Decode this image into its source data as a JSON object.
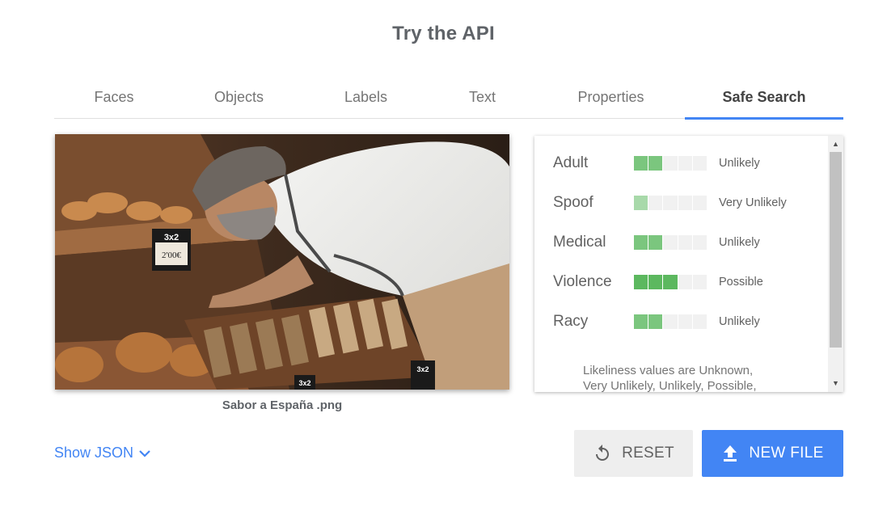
{
  "page": {
    "title": "Try the API"
  },
  "tabs": [
    {
      "label": "Faces",
      "active": false
    },
    {
      "label": "Objects",
      "active": false
    },
    {
      "label": "Labels",
      "active": false
    },
    {
      "label": "Text",
      "active": false
    },
    {
      "label": "Properties",
      "active": false
    },
    {
      "label": "Safe Search",
      "active": true
    }
  ],
  "image": {
    "caption": "Sabor a España .png",
    "sign_text": "3x2",
    "price_text": "2'00€"
  },
  "safe_search": {
    "rows": [
      {
        "category": "Adult",
        "likelihood": "Unlikely",
        "level": 2,
        "max": 5
      },
      {
        "category": "Spoof",
        "likelihood": "Very Unlikely",
        "level": 1,
        "max": 5
      },
      {
        "category": "Medical",
        "likelihood": "Unlikely",
        "level": 2,
        "max": 5
      },
      {
        "category": "Violence",
        "likelihood": "Possible",
        "level": 3,
        "max": 5
      },
      {
        "category": "Racy",
        "likelihood": "Unlikely",
        "level": 2,
        "max": 5
      }
    ],
    "note_line1": "Likeliness values are Unknown,",
    "note_line2": "Very Unlikely, Unlikely, Possible,"
  },
  "actions": {
    "show_json": "Show JSON",
    "reset": "RESET",
    "new_file": "NEW FILE"
  },
  "colors": {
    "accent": "#4285f4",
    "bar_on": "#7bc67e",
    "bar_off": "#f1f1f1"
  },
  "icons": [
    "chevron-down-icon",
    "refresh-icon",
    "upload-icon",
    "scroll-up-icon",
    "scroll-down-icon"
  ]
}
